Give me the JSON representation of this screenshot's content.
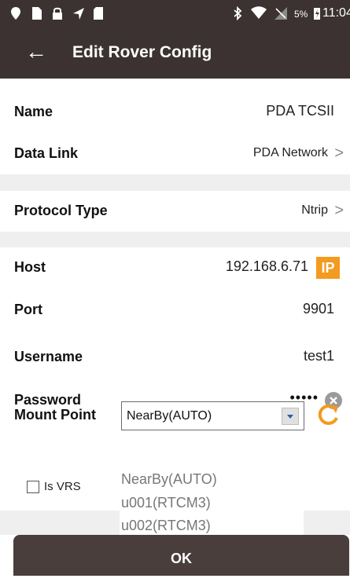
{
  "status_bar": {
    "battery": "5%",
    "time": "11:04"
  },
  "header": {
    "title": "Edit Rover Config"
  },
  "fields": {
    "name": {
      "label": "Name",
      "value": "PDA TCSII"
    },
    "datalink": {
      "label": "Data Link",
      "value": "PDA Network"
    },
    "protocol": {
      "label": "Protocol Type",
      "value": "Ntrip"
    },
    "host": {
      "label": "Host",
      "value": "192.168.6.71",
      "badge": "IP"
    },
    "port": {
      "label": "Port",
      "value": "9901"
    },
    "username": {
      "label": "Username",
      "value": "test1"
    },
    "password": {
      "label": "Password",
      "value": "•••••"
    },
    "mountpoint": {
      "label": "Mount Point",
      "selected": "NearBy(AUTO)"
    }
  },
  "is_vrs": {
    "label": "Is VRS",
    "checked": false
  },
  "dropdown_options": [
    "NearBy(AUTO)",
    "u001(RTCM3)",
    "u002(RTCM3)"
  ],
  "ok_label": "OK",
  "colors": {
    "header": "#3b3231",
    "accent": "#f39a1f",
    "ok_button": "#4a3e3c",
    "section_gap": "#efefef"
  }
}
